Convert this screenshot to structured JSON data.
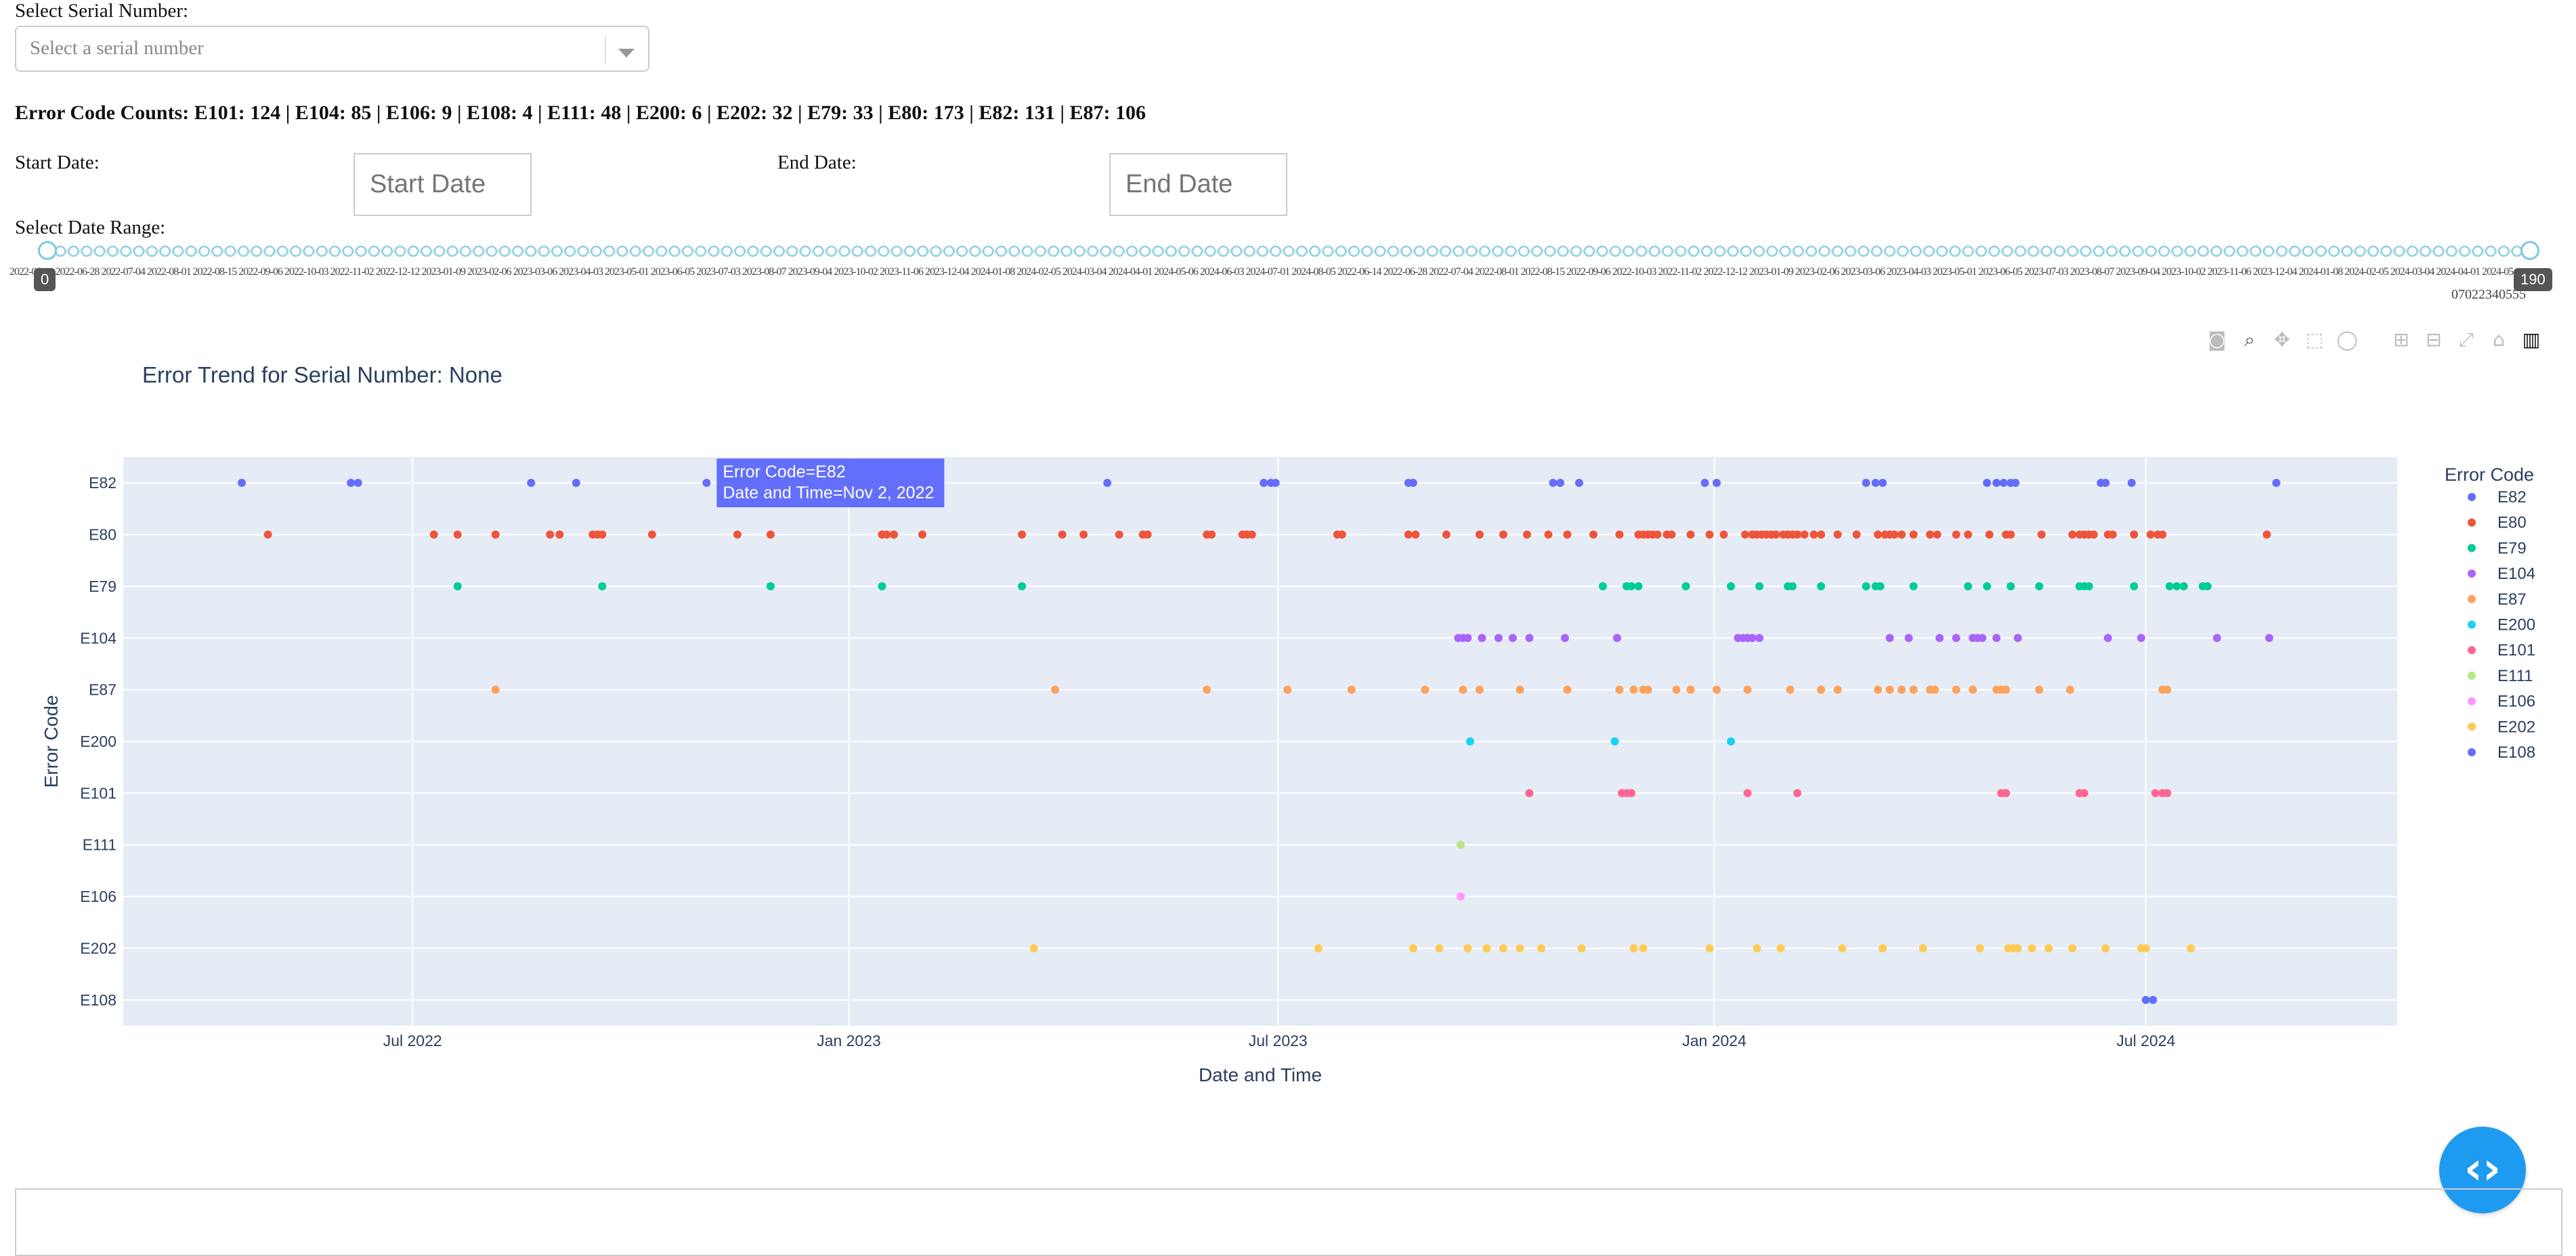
{
  "serial": {
    "label": "Select Serial Number:",
    "placeholder": "Select a serial number"
  },
  "counts_text": "Error Code Counts: E101: 124 | E104: 85 | E106: 9 | E108: 4 | E111: 48 | E200: 6 | E202: 32 | E79: 33 | E80: 173 | E82: 131 | E87: 106",
  "dates": {
    "start_label": "Start Date:",
    "start_placeholder": "Start Date",
    "end_label": "End Date:",
    "end_placeholder": "End Date"
  },
  "range": {
    "label": "Select Date Range:",
    "min_label": "0",
    "max_label": "190",
    "tick_text": "2022-06-14 2022-06-28 2022-07-04 2022-08-01 2022-08-15 2022-09-06 2022-10-03 2022-11-02 2022-12-12 2023-01-09 2023-02-06 2023-03-06 2023-04-03 2023-05-01 2023-06-05 2023-07-03 2023-08-07 2023-09-04 2023-10-02 2023-11-06 2023-12-04 2024-01-08 2024-02-05 2024-03-04 2024-04-01 2024-05-06 2024-06-03 2024-07-01 2024-08-05 2022-06-14 2022-06-28 2022-07-04 2022-08-01 2022-08-15 2022-09-06 2022-10-03 2022-11-02 2022-12-12 2023-01-09 2023-02-06 2023-03-06 2023-04-03 2023-05-01 2023-06-05 2023-07-03 2023-08-07 2023-09-04 2023-10-02 2023-11-06 2023-12-04 2024-01-08 2024-02-05 2024-03-04 2024-04-01 2024-05-06 2024-06-03",
    "end_tick_text": "07022340555"
  },
  "modebar": [
    "camera-icon",
    "zoom-icon",
    "pan-icon",
    "box-select-icon",
    "lasso-icon",
    "zoom-in-icon",
    "zoom-out-icon",
    "autoscale-icon",
    "reset-axes-icon",
    "plotly-logo-icon"
  ],
  "fab_glyph": "‹›",
  "chart_data": {
    "type": "scatter",
    "title": "Error Trend for Serial Number: None",
    "xlabel": "Date and Time",
    "ylabel": "Error Code",
    "x_ticks": [
      "Jul 2022",
      "Jan 2023",
      "Jul 2023",
      "Jan 2024",
      "Jul 2024"
    ],
    "xlim": [
      "2022-03-01",
      "2024-10-15"
    ],
    "categories": [
      "E82",
      "E80",
      "E79",
      "E104",
      "E87",
      "E200",
      "E101",
      "E111",
      "E106",
      "E202",
      "E108"
    ],
    "legend_title": "Error Code",
    "legend_position": "right",
    "grid": true,
    "tooltip": {
      "line1": "Error Code=E82",
      "line2": "Date and Time=Nov 2, 2022"
    },
    "series": [
      {
        "name": "E82",
        "color": "#636efa",
        "x": [
          "2022-04-20",
          "2022-06-05",
          "2022-06-08",
          "2022-08-20",
          "2022-09-08",
          "2022-11-02",
          "2023-04-20",
          "2023-06-25",
          "2023-06-28",
          "2023-06-30",
          "2023-08-25",
          "2023-08-27",
          "2023-10-25",
          "2023-10-28",
          "2023-11-05",
          "2023-12-28",
          "2024-01-02",
          "2024-03-05",
          "2024-03-09",
          "2024-03-12",
          "2024-04-25",
          "2024-04-29",
          "2024-05-02",
          "2024-05-05",
          "2024-05-07",
          "2024-06-12",
          "2024-06-14",
          "2024-06-25",
          "2024-08-25"
        ]
      },
      {
        "name": "E80",
        "color": "#ef553b",
        "x": [
          "2022-05-01",
          "2022-07-10",
          "2022-07-20",
          "2022-08-05",
          "2022-08-28",
          "2022-09-01",
          "2022-09-15",
          "2022-09-17",
          "2022-09-19",
          "2022-10-10",
          "2022-11-15",
          "2022-11-29",
          "2023-01-15",
          "2023-01-17",
          "2023-01-20",
          "2023-02-01",
          "2023-03-15",
          "2023-04-01",
          "2023-04-10",
          "2023-04-25",
          "2023-05-05",
          "2023-05-07",
          "2023-06-01",
          "2023-06-03",
          "2023-06-16",
          "2023-06-18",
          "2023-06-20",
          "2023-07-26",
          "2023-07-28",
          "2023-08-25",
          "2023-08-28",
          "2023-09-10",
          "2023-09-24",
          "2023-10-04",
          "2023-10-14",
          "2023-10-23",
          "2023-10-31",
          "2023-11-11",
          "2023-11-22",
          "2023-11-30",
          "2023-12-02",
          "2023-12-04",
          "2023-12-06",
          "2023-12-08",
          "2023-12-12",
          "2023-12-14",
          "2023-12-22",
          "2023-12-30",
          "2024-01-05",
          "2024-01-14",
          "2024-01-17",
          "2024-01-19",
          "2024-01-21",
          "2024-01-23",
          "2024-01-25",
          "2024-01-27",
          "2024-01-30",
          "2024-02-01",
          "2024-02-03",
          "2024-02-05",
          "2024-02-08",
          "2024-02-12",
          "2024-02-15",
          "2024-02-22",
          "2024-03-01",
          "2024-03-10",
          "2024-03-13",
          "2024-03-15",
          "2024-03-17",
          "2024-03-20",
          "2024-03-25",
          "2024-04-01",
          "2024-04-04",
          "2024-04-12",
          "2024-04-17",
          "2024-04-26",
          "2024-05-03",
          "2024-05-05",
          "2024-05-18",
          "2024-05-31",
          "2024-06-03",
          "2024-06-05",
          "2024-06-07",
          "2024-06-09",
          "2024-06-15",
          "2024-06-17",
          "2024-06-26",
          "2024-07-03",
          "2024-07-06",
          "2024-07-08",
          "2024-08-21"
        ]
      },
      {
        "name": "E79",
        "color": "#00cc96",
        "x": [
          "2022-07-20",
          "2022-09-19",
          "2022-11-29",
          "2023-01-15",
          "2023-03-15",
          "2023-11-15",
          "2023-11-25",
          "2023-11-27",
          "2023-11-30",
          "2023-12-20",
          "2024-01-08",
          "2024-01-20",
          "2024-02-01",
          "2024-02-03",
          "2024-02-15",
          "2024-03-05",
          "2024-03-09",
          "2024-03-11",
          "2024-03-25",
          "2024-04-17",
          "2024-04-25",
          "2024-05-05",
          "2024-05-17",
          "2024-06-03",
          "2024-06-05",
          "2024-06-07",
          "2024-06-26",
          "2024-07-11",
          "2024-07-14",
          "2024-07-17",
          "2024-07-25",
          "2024-07-27"
        ]
      },
      {
        "name": "E104",
        "color": "#ab63fa",
        "x": [
          "2023-09-15",
          "2023-09-17",
          "2023-09-19",
          "2023-09-25",
          "2023-10-02",
          "2023-10-08",
          "2023-10-15",
          "2023-10-30",
          "2023-11-21",
          "2024-01-11",
          "2024-01-13",
          "2024-01-15",
          "2024-01-17",
          "2024-01-20",
          "2024-03-15",
          "2024-03-23",
          "2024-04-05",
          "2024-04-12",
          "2024-04-19",
          "2024-04-21",
          "2024-04-23",
          "2024-04-29",
          "2024-05-08",
          "2024-06-15",
          "2024-06-29",
          "2024-07-31",
          "2024-08-22"
        ]
      },
      {
        "name": "E87",
        "color": "#ffa15a",
        "x": [
          "2022-08-05",
          "2023-03-29",
          "2023-06-01",
          "2023-07-05",
          "2023-08-01",
          "2023-09-01",
          "2023-09-17",
          "2023-09-24",
          "2023-10-11",
          "2023-10-31",
          "2023-11-22",
          "2023-11-28",
          "2023-12-02",
          "2023-12-04",
          "2023-12-16",
          "2023-12-22",
          "2024-01-02",
          "2024-01-15",
          "2024-02-02",
          "2024-02-15",
          "2024-02-22",
          "2024-03-10",
          "2024-03-15",
          "2024-03-20",
          "2024-03-25",
          "2024-04-01",
          "2024-04-03",
          "2024-04-12",
          "2024-04-19",
          "2024-04-29",
          "2024-05-01",
          "2024-05-03",
          "2024-05-17",
          "2024-05-30",
          "2024-07-08",
          "2024-07-10"
        ]
      },
      {
        "name": "E200",
        "color": "#19d3f3",
        "x": [
          "2023-09-20",
          "2023-11-20",
          "2024-01-08"
        ]
      },
      {
        "name": "E101",
        "color": "#ff6692",
        "x": [
          "2023-10-15",
          "2023-11-23",
          "2023-11-25",
          "2023-11-27",
          "2024-01-15",
          "2024-02-05",
          "2024-05-01",
          "2024-05-03",
          "2024-06-03",
          "2024-06-05",
          "2024-07-05",
          "2024-07-08",
          "2024-07-10"
        ]
      },
      {
        "name": "E111",
        "color": "#b6e880",
        "x": [
          "2023-09-16"
        ]
      },
      {
        "name": "E106",
        "color": "#ff97ff",
        "x": [
          "2023-09-16"
        ]
      },
      {
        "name": "E202",
        "color": "#fecb52",
        "x": [
          "2023-03-20",
          "2023-07-18",
          "2023-08-27",
          "2023-09-07",
          "2023-09-19",
          "2023-09-27",
          "2023-10-04",
          "2023-10-11",
          "2023-10-20",
          "2023-11-06",
          "2023-11-28",
          "2023-12-02",
          "2023-12-30",
          "2024-01-19",
          "2024-01-29",
          "2024-02-24",
          "2024-03-12",
          "2024-03-29",
          "2024-04-22",
          "2024-05-04",
          "2024-05-06",
          "2024-05-08",
          "2024-05-14",
          "2024-05-21",
          "2024-05-31",
          "2024-06-14",
          "2024-06-29",
          "2024-07-01",
          "2024-07-20"
        ]
      },
      {
        "name": "E108",
        "color": "#636efa",
        "x": [
          "2024-07-01",
          "2024-07-04"
        ]
      }
    ]
  }
}
